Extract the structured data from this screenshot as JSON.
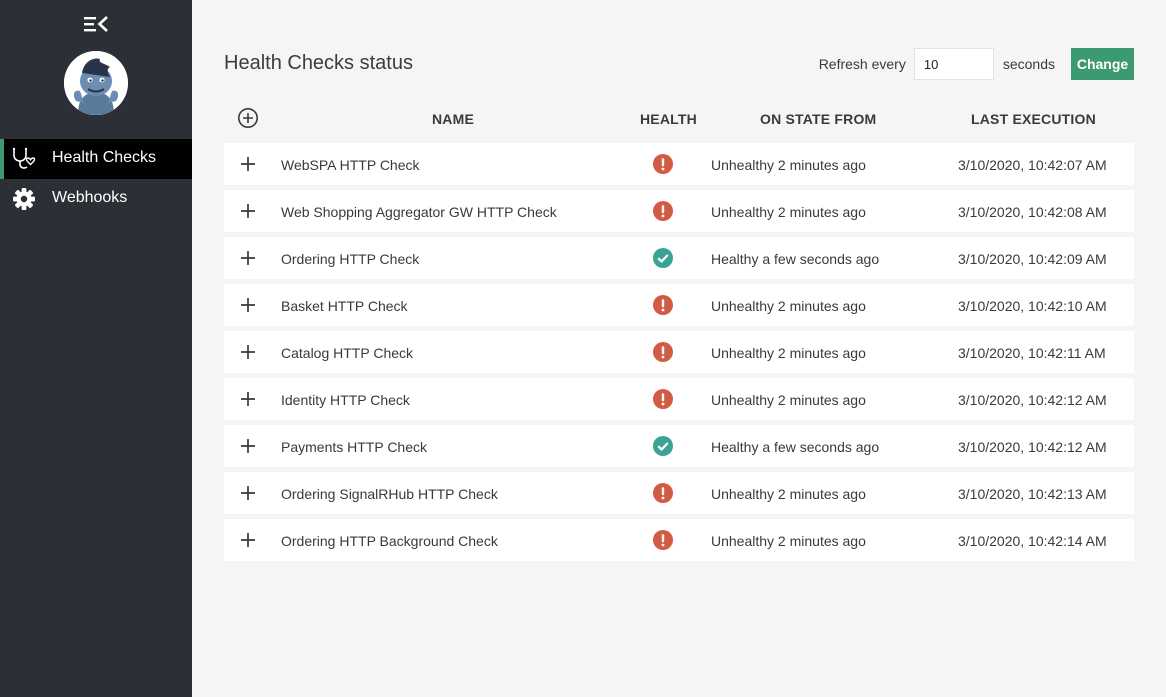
{
  "sidebar": {
    "nav": [
      {
        "label": "Health Checks",
        "icon": "stethoscope-icon",
        "active": true
      },
      {
        "label": "Webhooks",
        "icon": "gear-icon",
        "active": false
      }
    ]
  },
  "header": {
    "title": "Health Checks status",
    "refresh_label": "Refresh every",
    "refresh_value": "10",
    "seconds_label": "seconds",
    "change_label": "Change"
  },
  "table": {
    "columns": [
      "NAME",
      "HEALTH",
      "ON STATE FROM",
      "LAST EXECUTION"
    ],
    "rows": [
      {
        "name": "WebSPA HTTP Check",
        "health": "unhealthy",
        "state": "Unhealthy 2 minutes ago",
        "last_execution": "3/10/2020, 10:42:07 AM"
      },
      {
        "name": "Web Shopping Aggregator GW HTTP Check",
        "health": "unhealthy",
        "state": "Unhealthy 2 minutes ago",
        "last_execution": "3/10/2020, 10:42:08 AM"
      },
      {
        "name": "Ordering HTTP Check",
        "health": "healthy",
        "state": "Healthy a few seconds ago",
        "last_execution": "3/10/2020, 10:42:09 AM"
      },
      {
        "name": "Basket HTTP Check",
        "health": "unhealthy",
        "state": "Unhealthy 2 minutes ago",
        "last_execution": "3/10/2020, 10:42:10 AM"
      },
      {
        "name": "Catalog HTTP Check",
        "health": "unhealthy",
        "state": "Unhealthy 2 minutes ago",
        "last_execution": "3/10/2020, 10:42:11 AM"
      },
      {
        "name": "Identity HTTP Check",
        "health": "unhealthy",
        "state": "Unhealthy 2 minutes ago",
        "last_execution": "3/10/2020, 10:42:12 AM"
      },
      {
        "name": "Payments HTTP Check",
        "health": "healthy",
        "state": "Healthy a few seconds ago",
        "last_execution": "3/10/2020, 10:42:12 AM"
      },
      {
        "name": "Ordering SignalRHub HTTP Check",
        "health": "unhealthy",
        "state": "Unhealthy 2 minutes ago",
        "last_execution": "3/10/2020, 10:42:13 AM"
      },
      {
        "name": "Ordering HTTP Background Check",
        "health": "unhealthy",
        "state": "Unhealthy 2 minutes ago",
        "last_execution": "3/10/2020, 10:42:14 AM"
      }
    ]
  },
  "colors": {
    "sidebar_bg": "#2d2f36",
    "accent": "#3c9a72",
    "healthy": "#3aa394",
    "unhealthy": "#d15b43",
    "page_bg": "#f5f5f5"
  }
}
